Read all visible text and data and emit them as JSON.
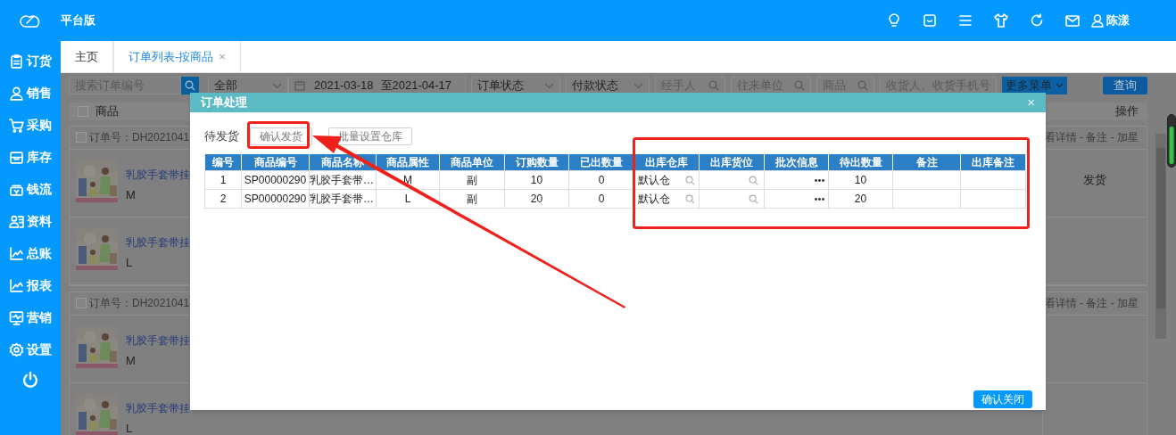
{
  "app": {
    "title": "平台版",
    "user": "陈漾"
  },
  "sidebar": {
    "items": [
      {
        "label": "订货"
      },
      {
        "label": "销售"
      },
      {
        "label": "采购"
      },
      {
        "label": "库存"
      },
      {
        "label": "钱流"
      },
      {
        "label": "资料"
      },
      {
        "label": "总账"
      },
      {
        "label": "报表"
      },
      {
        "label": "营销"
      },
      {
        "label": "设置"
      }
    ]
  },
  "tabs": [
    {
      "label": "主页",
      "selected": false,
      "closable": false
    },
    {
      "label": "订单列表-按商品",
      "selected": true,
      "closable": true,
      "close": "×"
    }
  ],
  "filters": {
    "search": {
      "placeholder": "搜索订单编号"
    },
    "scope": "全部",
    "date_from": "2021-03-18",
    "date_to": "至2021-04-17",
    "order_status": "订单状态",
    "pay_status": "付款状态",
    "handler": {
      "placeholder": "经手人"
    },
    "partner": {
      "placeholder": "往来单位"
    },
    "product": {
      "placeholder": "商品"
    },
    "receiver": {
      "placeholder": "收货人、收货手机号"
    },
    "more_menu": "更多菜单",
    "query": "查询"
  },
  "list": {
    "header": {
      "checked": false,
      "product": "商品",
      "actions": "操作"
    },
    "orders": [
      {
        "checked": false,
        "order_no": "订单号：DH2021041",
        "links": "看详情 - 备注 - 加星",
        "action": "发货",
        "items": [
          {
            "name": "乳胶手套带挂",
            "variant": "M"
          },
          {
            "name": "乳胶手套带挂",
            "variant": "L"
          }
        ]
      },
      {
        "checked": false,
        "order_no": "订单号：DH2021041",
        "links": "看详情 - 备注 - 加星",
        "items": [
          {
            "name": "乳胶手套带挂",
            "variant": "M"
          },
          {
            "name": "乳胶手套带挂",
            "variant": "L"
          }
        ]
      }
    ]
  },
  "dialog": {
    "title": "订单处理",
    "close": "×",
    "status_label": "待发货",
    "buttons": [
      "确认发货",
      "批量设置仓库"
    ],
    "table": {
      "columns": [
        "编号",
        "商品编号",
        "商品名称",
        "商品属性",
        "商品单位",
        "订购数量",
        "已出数量",
        "出库仓库",
        "出库货位",
        "批次信息",
        "待出数量",
        "备注",
        "出库备注"
      ],
      "rows": [
        {
          "no": "1",
          "code": "SP00000290",
          "name": "乳胶手套带…",
          "attr": "M",
          "unit": "副",
          "ordered": "10",
          "shipped": "0",
          "warehouse": "默认仓",
          "pending": "10"
        },
        {
          "no": "2",
          "code": "SP00000290",
          "name": "乳胶手套带…",
          "attr": "L",
          "unit": "副",
          "ordered": "20",
          "shipped": "0",
          "warehouse": "默认仓",
          "pending": "20"
        }
      ]
    },
    "footer_button": "确认关闭"
  }
}
